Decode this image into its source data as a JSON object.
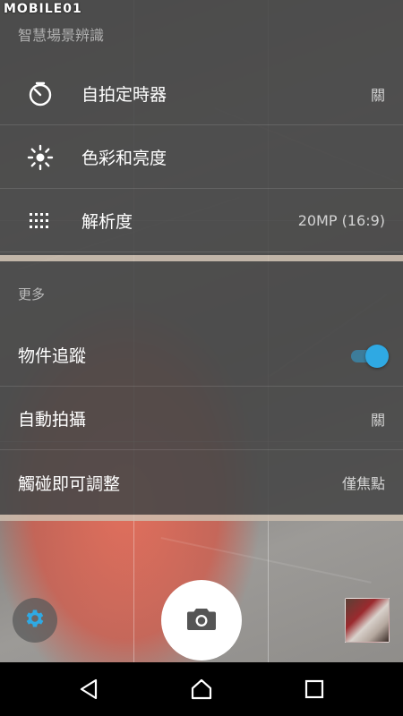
{
  "watermark": "MOBILE01",
  "scene": {
    "faded_item": "智慧場景辨識"
  },
  "camera_settings": {
    "items": [
      {
        "icon": "self-timer-icon",
        "label": "自拍定時器",
        "value": "關"
      },
      {
        "icon": "brightness-icon",
        "label": "色彩和亮度",
        "value": ""
      },
      {
        "icon": "resolution-grid-icon",
        "label": "解析度",
        "value": "20MP (16:9)"
      }
    ]
  },
  "more": {
    "header": "更多",
    "items": [
      {
        "label": "物件追蹤",
        "toggle_on": true
      },
      {
        "label": "自動拍攝",
        "value": "關"
      },
      {
        "label": "觸碰即可調整",
        "value": "僅焦點"
      }
    ]
  },
  "controls": {
    "settings_icon": "gear-icon",
    "shutter_icon": "camera-icon",
    "accent_color": "#2fa9e3"
  },
  "navbar": {
    "back_icon": "back-triangle-icon",
    "home_icon": "home-icon",
    "recents_icon": "recents-square-icon"
  }
}
